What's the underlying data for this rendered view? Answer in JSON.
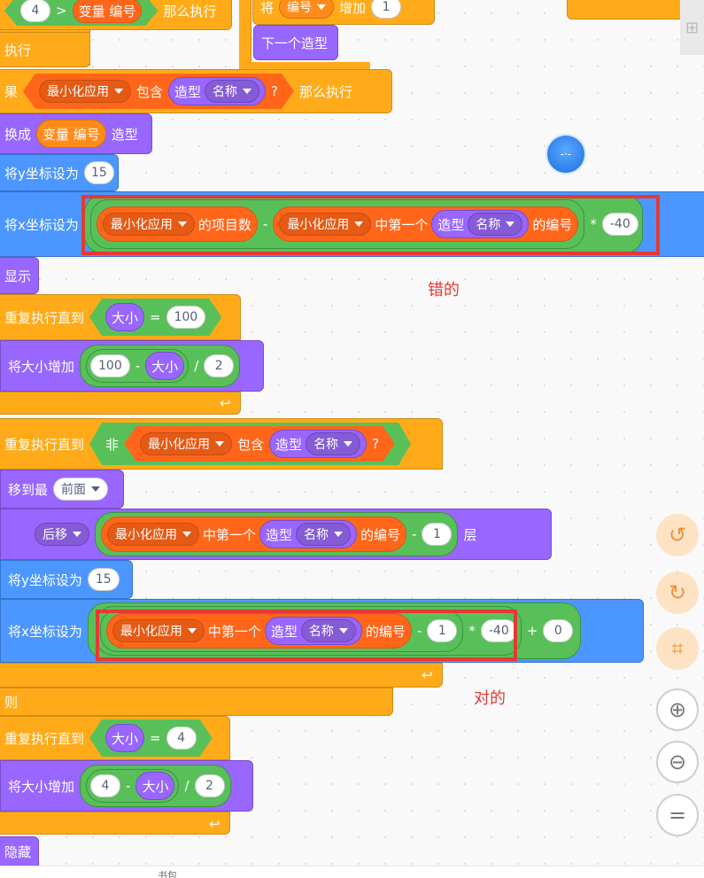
{
  "top": {
    "num_4": "4",
    "gt": ">",
    "var_label": "变量 编号",
    "then_exec": "那么执行",
    "set_label": "将",
    "var_dd": "编号",
    "increase": "增加",
    "num_1": "1",
    "next_costume": "下一个造型"
  },
  "rows": {
    "exec": "执行",
    "if_prefix": "果",
    "min_app": "最小化应用",
    "contains": "包含",
    "costume": "造型",
    "name": "名称",
    "qmark": "?",
    "then_exec": "那么执行",
    "switch_to": "换成",
    "var_number": "变量 编号",
    "costume_suffix": "造型",
    "set_y": "将y坐标设为",
    "y15": "15",
    "set_x": "将x坐标设为",
    "items_of": "的项目数",
    "minus": "-",
    "first_in": "中第一个",
    "index_of": "的编号",
    "times": "*",
    "neg40_cut": "-40",
    "show": "显示",
    "repeat_until": "重复执行直到",
    "size": "大小",
    "eq": "=",
    "n100": "100",
    "change_size": "将大小增加",
    "div": "/",
    "n2": "2",
    "not_label": "非",
    "goto_front": "移到最",
    "front": "前面",
    "back": "后移",
    "one": "1",
    "layers": "层",
    "neg40": "-40",
    "plus": "+",
    "zero": "0",
    "else": "则",
    "n4": "4",
    "hide": "隐藏"
  },
  "annotations": {
    "wrong": "错的",
    "right": "对的"
  },
  "tools": [
    "undo-icon",
    "redo-icon",
    "crop-icon",
    "zoom-in-icon",
    "zoom-out-icon",
    "reset-zoom-icon"
  ],
  "bottom": {
    "text": "书包"
  },
  "colors": {
    "control": "#ffab19",
    "looks": "#9966ff",
    "motion": "#4c97ff",
    "operators": "#59c059",
    "data": "#ff661a",
    "annotation": "#e53935"
  }
}
